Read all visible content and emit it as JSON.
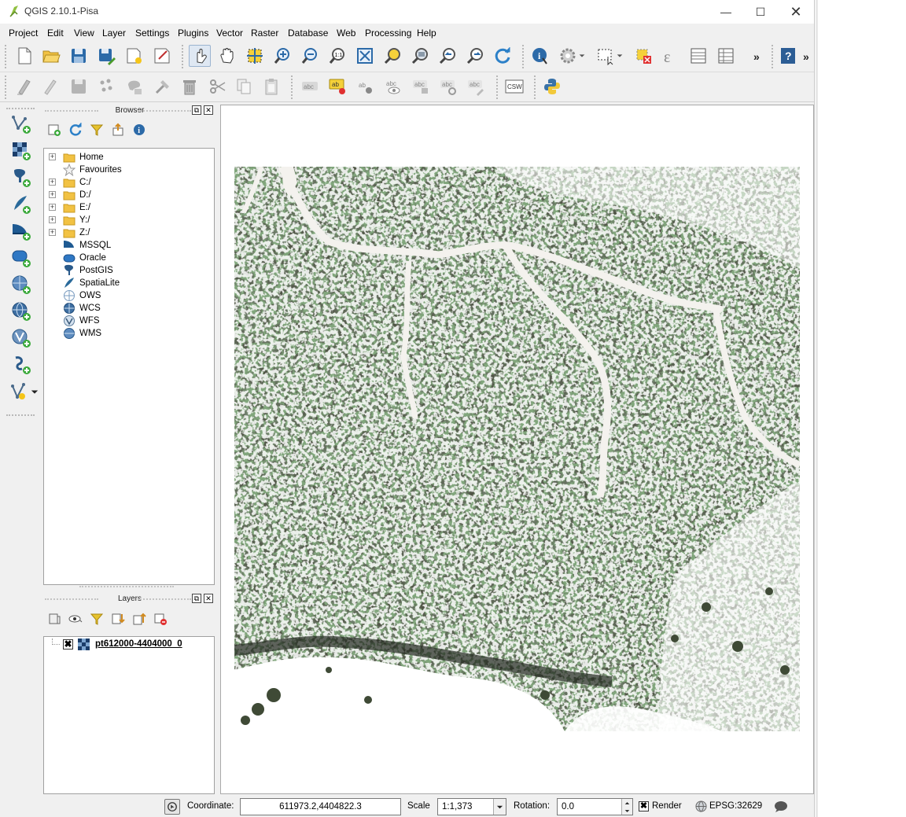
{
  "window": {
    "title": "QGIS 2.10.1-Pisa"
  },
  "menu": [
    "Project",
    "Edit",
    "View",
    "Layer",
    "Settings",
    "Plugins",
    "Vector",
    "Raster",
    "Database",
    "Web",
    "Processing",
    "Help"
  ],
  "toolbar_overflow": "»",
  "browser": {
    "title": "Browser",
    "items": [
      {
        "label": "Home",
        "icon": "folder-icon"
      },
      {
        "label": "Favourites",
        "icon": "star-icon"
      },
      {
        "label": "C:/",
        "icon": "folder-icon"
      },
      {
        "label": "D:/",
        "icon": "folder-icon"
      },
      {
        "label": "E:/",
        "icon": "folder-icon"
      },
      {
        "label": "Y:/",
        "icon": "folder-icon"
      },
      {
        "label": "Z:/",
        "icon": "folder-icon"
      },
      {
        "label": "MSSQL",
        "icon": "mssql-icon"
      },
      {
        "label": "Oracle",
        "icon": "oracle-icon"
      },
      {
        "label": "PostGIS",
        "icon": "postgis-icon"
      },
      {
        "label": "SpatiaLite",
        "icon": "spatialite-icon"
      },
      {
        "label": "OWS",
        "icon": "ows-icon"
      },
      {
        "label": "WCS",
        "icon": "wcs-icon"
      },
      {
        "label": "WFS",
        "icon": "wfs-icon"
      },
      {
        "label": "WMS",
        "icon": "wms-icon"
      }
    ]
  },
  "layers": {
    "title": "Layers",
    "items": [
      {
        "label": "pt612000-4404000_0",
        "checked": true
      }
    ]
  },
  "status": {
    "coordinate_label": "Coordinate:",
    "coordinate_value": "611973.2,4404822.3",
    "scale_label": "Scale",
    "scale_value": "1:1,373",
    "rotation_label": "Rotation:",
    "rotation_value": "0.0",
    "render_label": "Render",
    "render_checked": true,
    "crs": "EPSG:32629"
  },
  "colors": {
    "forest_dark": "#2e3a2a",
    "forest_green": "#3f5c34",
    "clearing": "#ffffff",
    "accent": "#3c7fc1"
  }
}
